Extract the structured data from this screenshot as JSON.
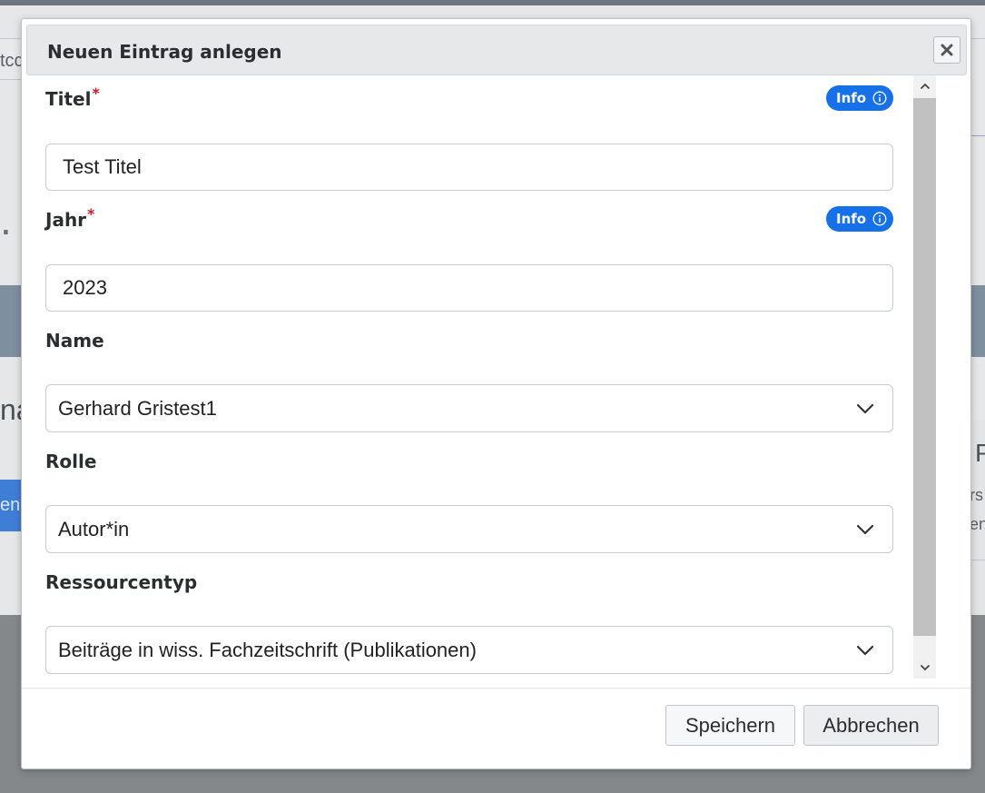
{
  "background": {
    "tab_fragment": "tcc",
    "heading_fragment": "na",
    "button_fragment": "en",
    "right_heading_fragment": "P",
    "right_text_1": "rs",
    "right_text_2": "en"
  },
  "dialog": {
    "title": "Neuen Eintrag anlegen",
    "close_icon": "close-icon",
    "fields": {
      "titel": {
        "label": "Titel",
        "required_mark": "*",
        "info_label": "Info",
        "value": "Test Titel"
      },
      "jahr": {
        "label": "Jahr",
        "required_mark": "*",
        "info_label": "Info",
        "value": "2023"
      },
      "name": {
        "label": "Name",
        "selected": "Gerhard Gristest1"
      },
      "rolle": {
        "label": "Rolle",
        "selected": "Autor*in"
      },
      "ressourcentyp": {
        "label": "Ressourcentyp",
        "selected": "Beiträge in wiss. Fachzeitschrift (Publikationen)"
      }
    },
    "footer": {
      "save_label": "Speichern",
      "cancel_label": "Abbrechen"
    }
  },
  "colors": {
    "accent": "#1670e8",
    "required": "#d11a2a",
    "overlay": "#8a8d90"
  }
}
